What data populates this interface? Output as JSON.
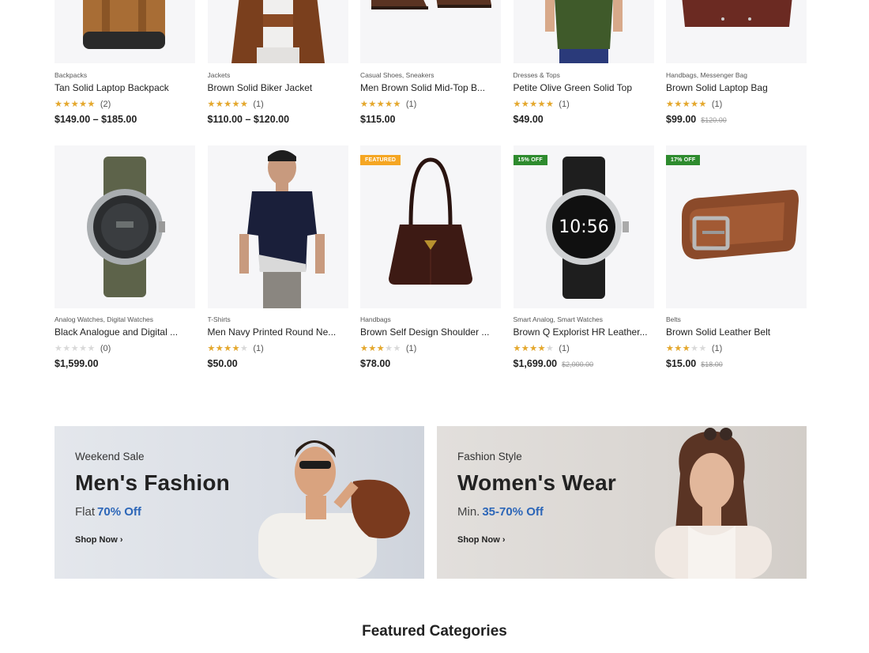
{
  "products_row1": [
    {
      "categories": "Backpacks",
      "name": "Tan Solid Laptop Backpack",
      "rating": 5,
      "reviews": "(2)",
      "price": "$149.00 – $185.00",
      "old_price": ""
    },
    {
      "categories": "Jackets",
      "name": "Brown Solid Biker Jacket",
      "rating": 5,
      "reviews": "(1)",
      "price": "$110.00 – $120.00",
      "old_price": ""
    },
    {
      "categories": "Casual Shoes, Sneakers",
      "name": "Men Brown Solid Mid-Top B...",
      "rating": 5,
      "reviews": "(1)",
      "price": "$115.00",
      "old_price": ""
    },
    {
      "categories": "Dresses & Tops",
      "name": "Petite Olive Green Solid Top",
      "rating": 5,
      "reviews": "(1)",
      "price": "$49.00",
      "old_price": ""
    },
    {
      "categories": "Handbags, Messenger Bag",
      "name": "Brown Solid Laptop Bag",
      "rating": 5,
      "reviews": "(1)",
      "price": "$99.00",
      "old_price": "$120.00"
    }
  ],
  "products_row2": [
    {
      "badge": "",
      "categories": "Analog Watches, Digital Watches",
      "name": "Black Analogue and Digital ...",
      "rating": 0,
      "reviews": "(0)",
      "price": "$1,599.00",
      "old_price": ""
    },
    {
      "badge": "",
      "categories": "T-Shirts",
      "name": "Men Navy Printed Round Ne...",
      "rating": 4,
      "reviews": "(1)",
      "price": "$50.00",
      "old_price": ""
    },
    {
      "badge": "Featured",
      "categories": "Handbags",
      "name": "Brown Self Design Shoulder ...",
      "rating": 3,
      "reviews": "(1)",
      "price": "$78.00",
      "old_price": ""
    },
    {
      "badge": "15% Off",
      "categories": "Smart Analog, Smart Watches",
      "name": "Brown Q Explorist HR Leather...",
      "rating": 4,
      "reviews": "(1)",
      "price": "$1,699.00",
      "old_price": "$2,000.00"
    },
    {
      "badge": "17% Off",
      "categories": "Belts",
      "name": "Brown Solid Leather Belt",
      "rating": 3,
      "reviews": "(1)",
      "price": "$15.00",
      "old_price": "$18.00"
    }
  ],
  "banners": {
    "men": {
      "subtitle": "Weekend Sale",
      "title": "Men's Fashion",
      "offer_prefix": "Flat",
      "offer_highlight": "70% Off",
      "cta": "Shop Now"
    },
    "women": {
      "subtitle": "Fashion Style",
      "title": "Women's Wear",
      "offer_prefix": "Min.",
      "offer_highlight": "35-70% Off",
      "cta": "Shop Now"
    }
  },
  "section": {
    "featured_categories_title": "Featured Categories"
  },
  "colors": {
    "star": "#e6a82b",
    "featured_badge": "#f5a623",
    "sale_badge": "#2e8b2e",
    "offer_highlight": "#2c66b8"
  }
}
